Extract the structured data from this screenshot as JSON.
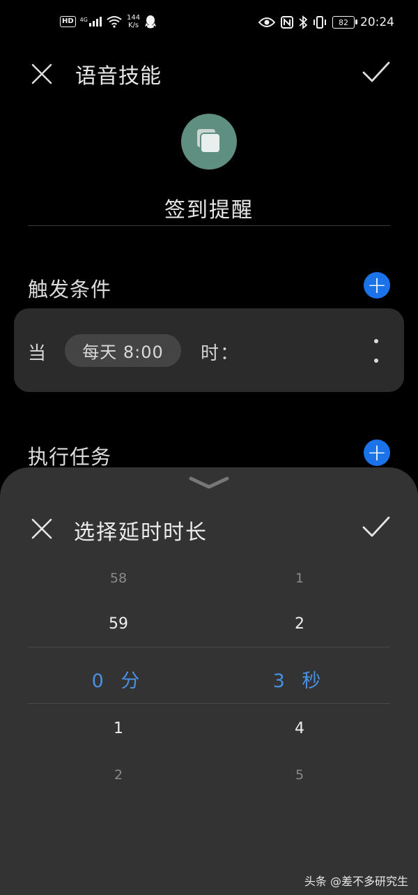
{
  "status_bar": {
    "hd": "HD",
    "network": "4G",
    "speed_value": "144",
    "speed_unit": "K/s",
    "battery": "82",
    "time": "20:24"
  },
  "header": {
    "title": "语音技能"
  },
  "skill": {
    "name": "签到提醒"
  },
  "trigger_section": {
    "title": "触发条件",
    "when_label": "当",
    "schedule_chip": "每天 8:00",
    "time_suffix": "时："
  },
  "task_section": {
    "title": "执行任务"
  },
  "delay_sheet": {
    "title": "选择延时时长",
    "minutes": {
      "far_above": "58",
      "above": "59",
      "selected": "0 分",
      "below": "1",
      "far_below": "2"
    },
    "seconds": {
      "far_above": "1",
      "above": "2",
      "selected": "3 秒",
      "below": "4",
      "far_below": "5"
    }
  },
  "watermark": "头条 @差不多研究生",
  "colors": {
    "accent_blue": "#1a73e8",
    "picker_selected": "#4a90e2",
    "icon_teal": "#5f8f80",
    "sheet_bg": "#333333",
    "card_bg": "#2b2b2b"
  },
  "icons": {
    "close": "close-icon",
    "confirm": "check-icon",
    "add": "plus-icon",
    "more": "more-vertical-icon",
    "app": "stacked-squares-icon",
    "collapse": "chevron-down-icon"
  }
}
